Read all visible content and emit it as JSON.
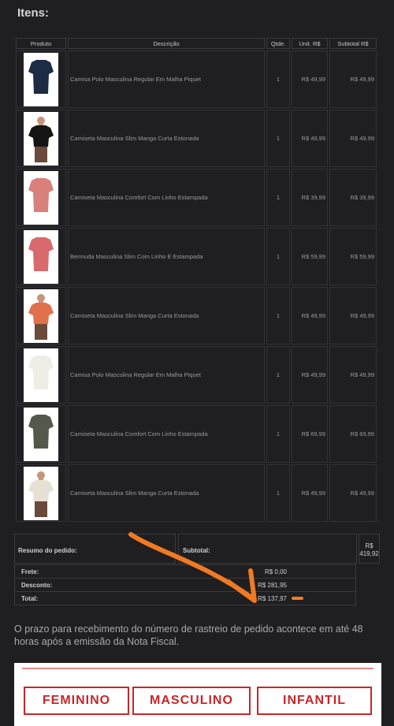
{
  "title": "Itens:",
  "table": {
    "headers": {
      "product": "Produto",
      "description": "Descrição",
      "qty": "Qtde.",
      "unit": "Unit. R$",
      "subtotal": "Subtotal R$"
    },
    "rows": [
      {
        "description": "Camisa Polo Masculina Regular Em Malha Piquet",
        "qty": "1",
        "unit": "R$ 49,99",
        "subtotal": "R$ 49,99",
        "shirt_color": "#1e2b44",
        "skin": false
      },
      {
        "description": "Camiseta Masculina Slim Manga Curta Estonada",
        "qty": "1",
        "unit": "R$ 49,99",
        "subtotal": "R$ 49,99",
        "shirt_color": "#151515",
        "skin": true
      },
      {
        "description": "Camiseta Masculina Comfort Com Linho Estampada",
        "qty": "1",
        "unit": "R$ 39,99",
        "subtotal": "R$ 39,99",
        "shirt_color": "#d9807a",
        "skin": false
      },
      {
        "description": "Bermuda Masculina Slim Com Linho E Estampada",
        "qty": "1",
        "unit": "R$ 59,99",
        "subtotal": "R$ 59,99",
        "shirt_color": "#d86a6e",
        "skin": false
      },
      {
        "description": "Camiseta Masculina Slim Manga Curta Estonada",
        "qty": "1",
        "unit": "R$ 49,99",
        "subtotal": "R$ 49,99",
        "shirt_color": "#e0714a",
        "skin": true
      },
      {
        "description": "Camisa Polo Masculina Regular Em Malha Piquet",
        "qty": "1",
        "unit": "R$ 49,99",
        "subtotal": "R$ 49,99",
        "shirt_color": "#efeee6",
        "skin": false
      },
      {
        "description": "Camiseta Masculina Comfort Com Linho Estampada",
        "qty": "1",
        "unit": "R$ 69,99",
        "subtotal": "R$ 69,99",
        "shirt_color": "#535a4c",
        "skin": false
      },
      {
        "description": "Camiseta Masculina Slim Manga Curta Estonada",
        "qty": "1",
        "unit": "R$ 49,99",
        "subtotal": "R$ 49,99",
        "shirt_color": "#e7e1d5",
        "skin": true
      }
    ]
  },
  "summary": {
    "label": "Resumo do pedido:",
    "subtotal_label": "Subtotal:",
    "subtotal_value_line1": "R$",
    "subtotal_value_line2": "419,92",
    "freight_label": "Frete:",
    "freight_value": "R$ 0,00",
    "discount_label": "Desconto:",
    "discount_value": "R$ 281,95",
    "total_label": "Total:",
    "total_value": "R$ 137,97"
  },
  "note": "O prazo para recebimento do número de rastreio de pedido acontece em até 48 horas após a emissão da Nota Fiscal.",
  "banner": {
    "feminino": "FEMININO",
    "masculino": "MASCULINO",
    "infantil": "INFANTIL"
  },
  "colors": {
    "accent_red": "#c7262a",
    "arrow_orange": "#f07a22",
    "background": "#1f1f22"
  }
}
